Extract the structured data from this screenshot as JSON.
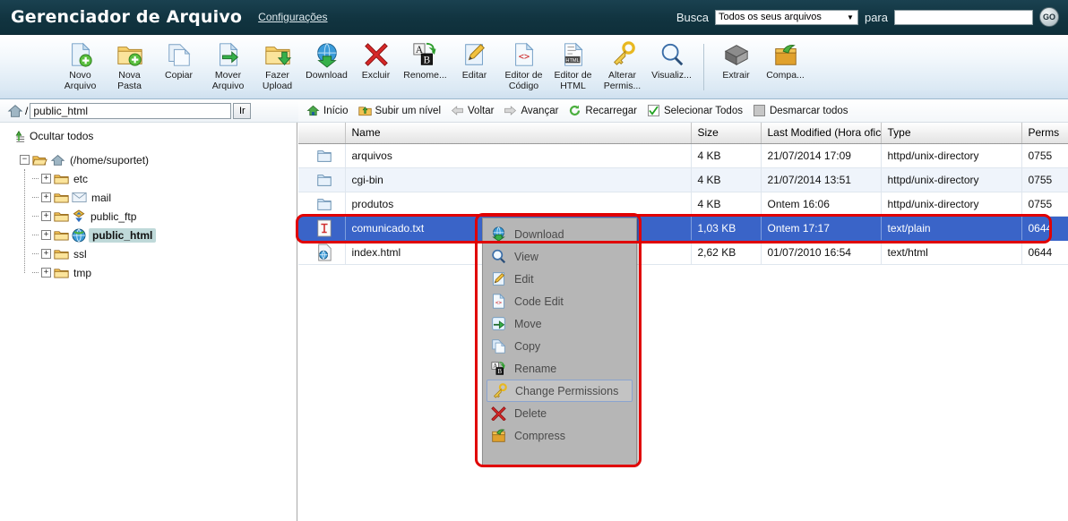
{
  "header": {
    "title": "Gerenciador de Arquivo",
    "settings_link": "Configurações",
    "search_label": "Busca",
    "search_scope_value": "Todos os seus arquivos",
    "search_scope_options": [
      "Todos os seus arquivos"
    ],
    "search_for_label": "para",
    "search_input_value": "",
    "go_button": "GO"
  },
  "toolbar": {
    "items": [
      {
        "label": "Novo\nArquivo",
        "icon": "new-file-icon"
      },
      {
        "label": "Nova\nPasta",
        "icon": "new-folder-icon"
      },
      {
        "label": "Copiar",
        "icon": "copy-icon"
      },
      {
        "label": "Mover\nArquivo",
        "icon": "move-file-icon"
      },
      {
        "label": "Fazer\nUpload",
        "icon": "upload-icon"
      },
      {
        "label": "Download",
        "icon": "download-icon"
      },
      {
        "label": "Excluir",
        "icon": "delete-icon"
      },
      {
        "label": "Renome...",
        "icon": "rename-icon"
      },
      {
        "label": "Editar",
        "icon": "edit-icon"
      },
      {
        "label": "Editor de\nCódigo",
        "icon": "code-editor-icon"
      },
      {
        "label": "Editor de\nHTML",
        "icon": "html-editor-icon"
      },
      {
        "label": "Alterar\nPermis...",
        "icon": "permissions-key-icon"
      },
      {
        "label": "Visualiz...",
        "icon": "view-magnifier-icon"
      },
      {
        "label": "Extrair",
        "icon": "extract-icon"
      },
      {
        "label": "Compa...",
        "icon": "compress-icon"
      }
    ]
  },
  "pathbar": {
    "path_value": "public_html",
    "go_label": "Ir",
    "home_prefix": "/"
  },
  "navbar": {
    "items": [
      {
        "label": "Início",
        "icon": "home-icon"
      },
      {
        "label": "Subir um nível",
        "icon": "up-level-icon"
      },
      {
        "label": "Voltar",
        "icon": "back-arrow-icon"
      },
      {
        "label": "Avançar",
        "icon": "forward-arrow-icon"
      },
      {
        "label": "Recarregar",
        "icon": "reload-icon"
      },
      {
        "label": "Selecionar Todos",
        "icon": "checkbox-checked-icon"
      },
      {
        "label": "Desmarcar todos",
        "icon": "checkbox-empty-icon"
      }
    ]
  },
  "sidebar": {
    "hide_all_label": "Ocultar todos",
    "root": {
      "label": "(/home/suportet)",
      "expander": "−"
    },
    "nodes": [
      {
        "label": "etc",
        "expander": "+",
        "icon": "folder-icon",
        "selected": false
      },
      {
        "label": "mail",
        "expander": "+",
        "icon": "mail-icon",
        "selected": false
      },
      {
        "label": "public_ftp",
        "expander": "+",
        "icon": "ftp-icon",
        "selected": false
      },
      {
        "label": "public_html",
        "expander": "+",
        "icon": "globe-icon",
        "selected": true
      },
      {
        "label": "ssl",
        "expander": "+",
        "icon": "folder-icon",
        "selected": false
      },
      {
        "label": "tmp",
        "expander": "+",
        "icon": "folder-icon",
        "selected": false
      }
    ]
  },
  "filetable": {
    "columns": [
      "",
      "Name",
      "Size",
      "Last Modified (Hora oficia",
      "Type",
      "Perms"
    ],
    "rows": [
      {
        "icon": "folder-icon",
        "name": "arquivos",
        "size": "4 KB",
        "modified": "21/07/2014 17:09",
        "type": "httpd/unix-directory",
        "perms": "0755",
        "selected": false
      },
      {
        "icon": "folder-icon",
        "name": "cgi-bin",
        "size": "4 KB",
        "modified": "21/07/2014 13:51",
        "type": "httpd/unix-directory",
        "perms": "0755",
        "selected": false
      },
      {
        "icon": "folder-icon",
        "name": "produtos",
        "size": "4 KB",
        "modified": "Ontem 16:06",
        "type": "httpd/unix-directory",
        "perms": "0755",
        "selected": false
      },
      {
        "icon": "text-file-icon",
        "name": "comunicado.txt",
        "size": "1,03 KB",
        "modified": "Ontem 17:17",
        "type": "text/plain",
        "perms": "0644",
        "selected": true
      },
      {
        "icon": "html-file-icon",
        "name": "index.html",
        "size": "2,62 KB",
        "modified": "01/07/2010 16:54",
        "type": "text/html",
        "perms": "0644",
        "selected": false
      }
    ]
  },
  "context_menu": {
    "items": [
      {
        "label": "Download",
        "icon": "download-icon",
        "highlighted": false
      },
      {
        "label": "View",
        "icon": "view-magnifier-icon",
        "highlighted": false
      },
      {
        "label": "Edit",
        "icon": "edit-icon",
        "highlighted": false
      },
      {
        "label": "Code Edit",
        "icon": "code-editor-icon",
        "highlighted": false
      },
      {
        "label": "Move",
        "icon": "move-file-icon",
        "highlighted": false
      },
      {
        "label": "Copy",
        "icon": "copy-icon",
        "highlighted": false
      },
      {
        "label": "Rename",
        "icon": "rename-icon",
        "highlighted": false
      },
      {
        "label": "Change Permissions",
        "icon": "permissions-key-icon",
        "highlighted": true
      },
      {
        "label": "Delete",
        "icon": "delete-icon",
        "highlighted": false
      },
      {
        "label": "Compress",
        "icon": "compress-icon",
        "highlighted": false
      }
    ]
  },
  "colors": {
    "header_bg": "#133743",
    "selection_blue": "#3a64c8",
    "annotation_red": "#e00000",
    "tree_selection": "#bfd9d9",
    "row_alt": "#eff4fb"
  }
}
